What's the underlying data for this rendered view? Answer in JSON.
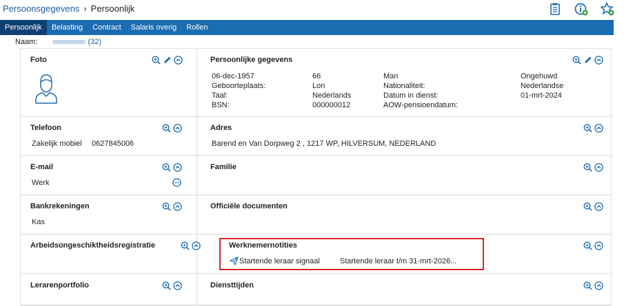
{
  "breadcrumb": {
    "parent": "Persoonsgegevens",
    "separator": "›",
    "current": "Persoonlijk"
  },
  "tabs": [
    "Persoonlijk",
    "Belasting",
    "Contract",
    "Salaris overig",
    "Rollen"
  ],
  "naam": {
    "label": "Naam:",
    "count": "(32)"
  },
  "foto": {
    "title": "Foto"
  },
  "persoonlijke": {
    "title": "Persoonlijke gegevens",
    "col1": [
      "06-dec-1957",
      "Geboorteplaats:",
      "Taal:",
      "BSN:"
    ],
    "col2": [
      "66",
      "Lon",
      "Nederlands",
      "000000012"
    ],
    "col3": [
      "Man",
      "Nationaliteit:",
      "Datum in dienst:",
      "AOW-pensioendatum:"
    ],
    "col4": [
      "Ongehuwd",
      "Nederlandse",
      "01-mrt-2024",
      ""
    ]
  },
  "telefoon": {
    "title": "Telefoon",
    "type": "Zakelijk mobiel",
    "number": "0627845006"
  },
  "adres": {
    "title": "Adres",
    "value": "Barend en Van Dorpweg 2 , 1217 WP, HILVERSUM, NEDERLAND"
  },
  "email": {
    "title": "E-mail",
    "type": "Werk"
  },
  "familie": {
    "title": "Familie"
  },
  "bank": {
    "title": "Bankrekeningen",
    "value": "Kas"
  },
  "officiele": {
    "title": "Officiële documenten"
  },
  "arbeids": {
    "title": "Arbeidsongeschiktheidsregistratie"
  },
  "notities": {
    "title": "Werknemernotities",
    "label": "Startende leraar signaal",
    "text": "Startende leraar t/m 31-mrt-2026..."
  },
  "portfolio": {
    "title": "Lerarenportfolio"
  },
  "diensttijden": {
    "title": "Diensttijden"
  },
  "colors": {
    "tabbar": "#1b6cb0",
    "tab_active": "#0e3f73",
    "link": "#1a5fa8",
    "icon": "#1b6cb0",
    "highlight": "#d9232d"
  }
}
